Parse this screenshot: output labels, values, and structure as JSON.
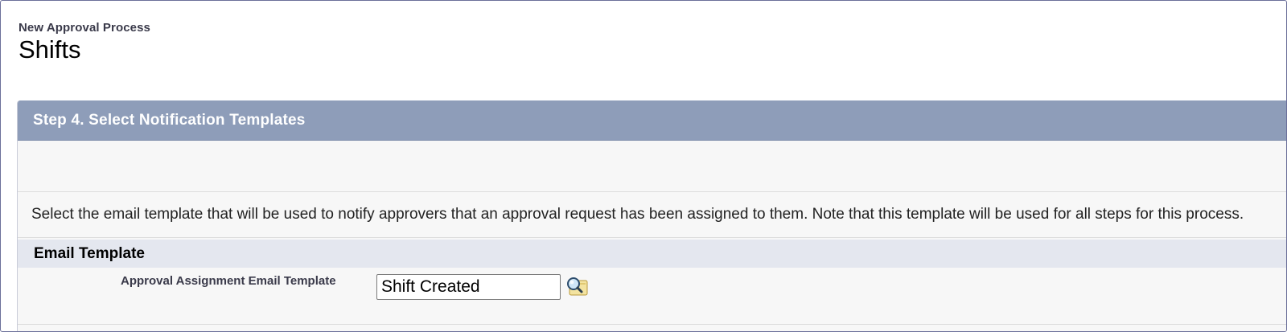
{
  "header": {
    "subtitle": "New Approval Process",
    "title": "Shifts"
  },
  "step": {
    "title": "Step 4. Select Notification Templates",
    "instructions": "Select the email template that will be used to notify approvers that an approval request has been assigned to them. Note that this template will be used for all steps for this process."
  },
  "section": {
    "title": "Email Template"
  },
  "field": {
    "label": "Approval Assignment Email Template",
    "value": "Shift Created",
    "lookup_icon": "magnifier-lookup-icon"
  },
  "colors": {
    "step_header_bg": "#8e9db9",
    "section_header_bg": "#e4e7ef",
    "panel_bg": "#f7f7f7"
  }
}
